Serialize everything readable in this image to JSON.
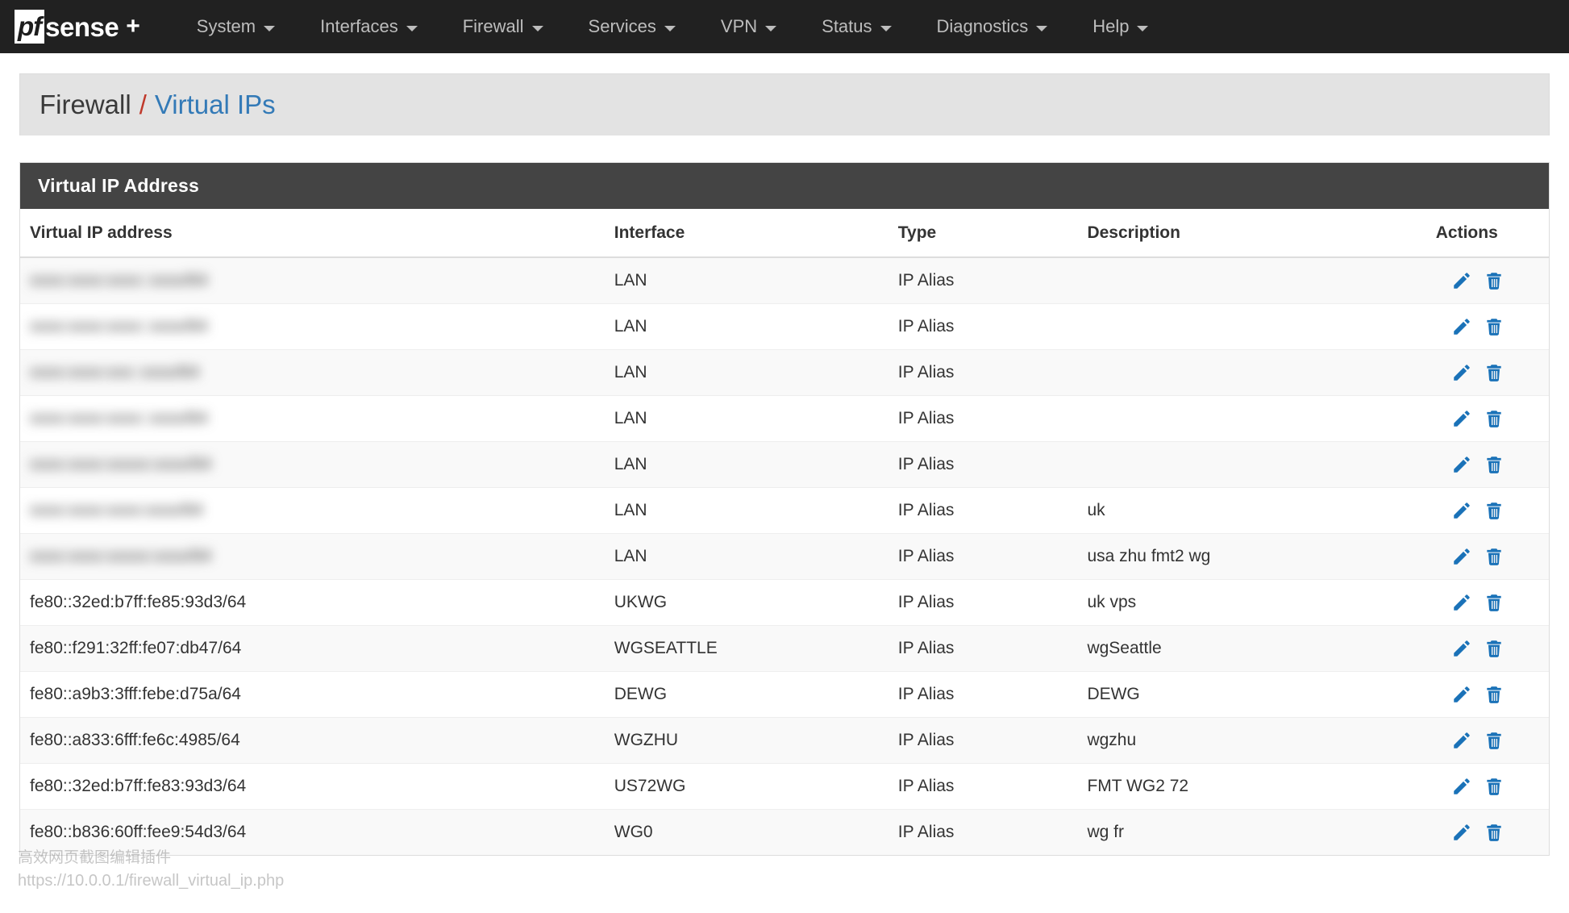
{
  "brand": {
    "logo_mark": "pf",
    "logo_word": "sense",
    "logo_plus": "+"
  },
  "nav": {
    "items": [
      {
        "label": "System",
        "has_caret": true
      },
      {
        "label": "Interfaces",
        "has_caret": true
      },
      {
        "label": "Firewall",
        "has_caret": true
      },
      {
        "label": "Services",
        "has_caret": true
      },
      {
        "label": "VPN",
        "has_caret": true
      },
      {
        "label": "Status",
        "has_caret": true
      },
      {
        "label": "Diagnostics",
        "has_caret": true
      },
      {
        "label": "Help",
        "has_caret": true
      }
    ]
  },
  "breadcrumb": {
    "root": "Firewall",
    "separator": "/",
    "leaf": "Virtual IPs"
  },
  "panel": {
    "heading": "Virtual IP Address"
  },
  "table": {
    "columns": [
      "Virtual IP address",
      "Interface",
      "Type",
      "Description",
      "Actions"
    ],
    "rows": [
      {
        "ip": "xxxx:xxxx:xxxx::xxxx/64",
        "redacted": true,
        "interface": "LAN",
        "type": "IP Alias",
        "description": ""
      },
      {
        "ip": "xxxx:xxxx:xxxx::xxxx/64",
        "redacted": true,
        "interface": "LAN",
        "type": "IP Alias",
        "description": ""
      },
      {
        "ip": "xxxx:xxxx:xxx::xxxx/64",
        "redacted": true,
        "interface": "LAN",
        "type": "IP Alias",
        "description": ""
      },
      {
        "ip": "xxxx:xxxx:xxxx::xxxx/64",
        "redacted": true,
        "interface": "LAN",
        "type": "IP Alias",
        "description": ""
      },
      {
        "ip": "xxxx:xxxx:xxxxx:xxxx/64",
        "redacted": true,
        "interface": "LAN",
        "type": "IP Alias",
        "description": ""
      },
      {
        "ip": "xxxx:xxxx:xxxx:xxxx/64",
        "redacted": true,
        "interface": "LAN",
        "type": "IP Alias",
        "description": "uk"
      },
      {
        "ip": "xxxx:xxxx:xxxxx:xxxx/64",
        "redacted": true,
        "interface": "LAN",
        "type": "IP Alias",
        "description": "usa zhu fmt2 wg"
      },
      {
        "ip": "fe80::32ed:b7ff:fe85:93d3/64",
        "redacted": false,
        "interface": "UKWG",
        "type": "IP Alias",
        "description": "uk vps"
      },
      {
        "ip": "fe80::f291:32ff:fe07:db47/64",
        "redacted": false,
        "interface": "WGSEATTLE",
        "type": "IP Alias",
        "description": "wgSeattle"
      },
      {
        "ip": "fe80::a9b3:3fff:febe:d75a/64",
        "redacted": false,
        "interface": "DEWG",
        "type": "IP Alias",
        "description": "DEWG"
      },
      {
        "ip": "fe80::a833:6fff:fe6c:4985/64",
        "redacted": false,
        "interface": "WGZHU",
        "type": "IP Alias",
        "description": "wgzhu"
      },
      {
        "ip": "fe80::32ed:b7ff:fe83:93d3/64",
        "redacted": false,
        "interface": "US72WG",
        "type": "IP Alias",
        "description": "FMT WG2 72"
      },
      {
        "ip": "fe80::b836:60ff:fee9:54d3/64",
        "redacted": false,
        "interface": "WG0",
        "type": "IP Alias",
        "description": "wg fr"
      }
    ],
    "row_actions": {
      "edit_icon": "pencil-icon",
      "delete_icon": "trash-icon"
    }
  },
  "watermark": {
    "line1": "高效网页截图编辑插件",
    "line2": "https://10.0.0.1/firewall_virtual_ip.php"
  },
  "colors": {
    "navbar_bg": "#212121",
    "panel_heading_bg": "#444444",
    "breadcrumb_bg": "#e3e3e3",
    "link_blue": "#337ab7",
    "separator_red": "#c0392b",
    "icon_blue": "#1a72b8"
  }
}
